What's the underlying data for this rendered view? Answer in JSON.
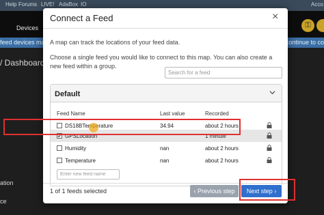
{
  "background": {
    "topbar": [
      "Help",
      "Forums",
      "LIVE!",
      "AdaBox",
      "IO"
    ],
    "nav_devices": "Devices",
    "banner_left": "feed devices may have",
    "banner_right": "continue to conne",
    "account_text": "Acco",
    "breadcrumb": "/ Dashboards",
    "side_item_1": "ation",
    "side_item_2": "ce"
  },
  "modal": {
    "title": "Connect a Feed",
    "close_glyph": "×",
    "intro": "A map can track the locations of your feed data.",
    "instructions": "Choose a single feed you would like to connect to this map. You can also create a new feed within a group.",
    "search_placeholder": "Search for a feed",
    "group": {
      "name": "Default",
      "columns": [
        "Feed Name",
        "Last value",
        "Recorded"
      ],
      "feeds": [
        {
          "name": "DS18BTemperature",
          "last_value": "34.94",
          "recorded": "about 2 hours",
          "checked": false
        },
        {
          "name": "GPSLocation",
          "last_value": "",
          "recorded": "1 minute",
          "checked": true
        },
        {
          "name": "Humidity",
          "last_value": "nan",
          "recorded": "about 2 hours",
          "checked": false
        },
        {
          "name": "Temperature",
          "last_value": "nan",
          "recorded": "about 2 hours",
          "checked": false
        }
      ],
      "new_feed_placeholder": "Enter new feed name"
    },
    "selected_count": "1 of 1 feeds selected",
    "previous_label": "Previous step",
    "next_label": "Next step"
  },
  "colors": {
    "accent_blue": "#2f6fce",
    "highlight_red": "#e03030",
    "prev_gray": "#9aa3ad"
  }
}
